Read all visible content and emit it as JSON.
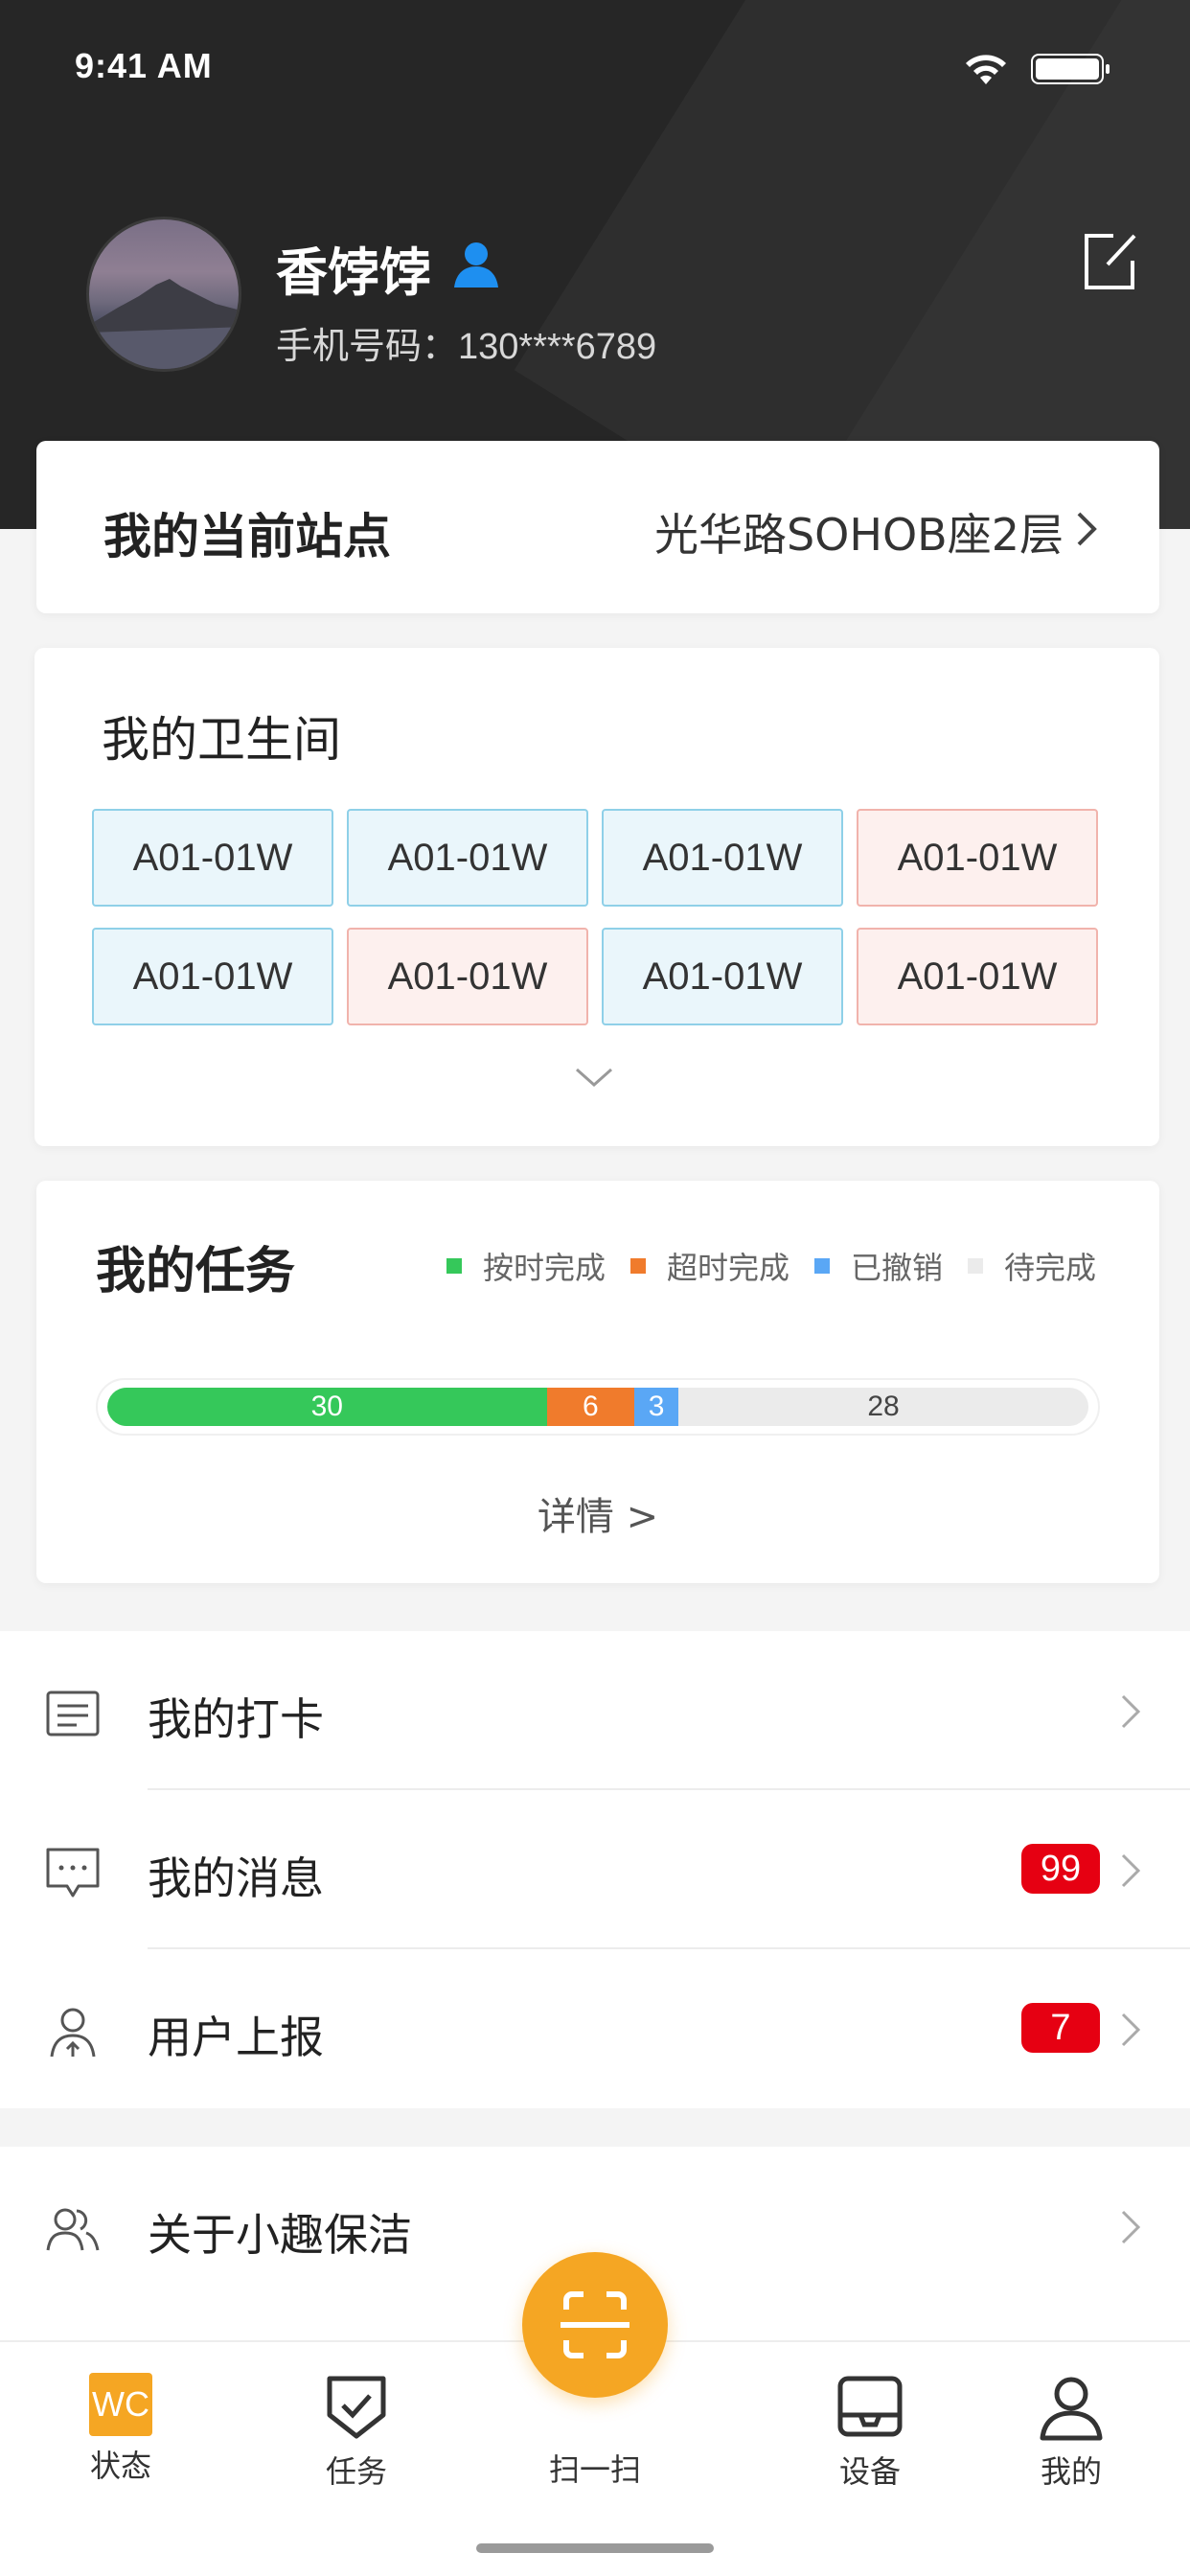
{
  "status_bar": {
    "time": "9:41 AM"
  },
  "profile": {
    "name": "香饽饽",
    "phone_label": "手机号码：",
    "phone": "130****6789"
  },
  "station": {
    "label": "我的当前站点",
    "value": "光华路SOHOB座2层"
  },
  "restrooms": {
    "title": "我的卫生间",
    "items": [
      {
        "code": "A01-01W",
        "status": "blue"
      },
      {
        "code": "A01-01W",
        "status": "blue"
      },
      {
        "code": "A01-01W",
        "status": "blue"
      },
      {
        "code": "A01-01W",
        "status": "red"
      },
      {
        "code": "A01-01W",
        "status": "blue"
      },
      {
        "code": "A01-01W",
        "status": "red"
      },
      {
        "code": "A01-01W",
        "status": "blue"
      },
      {
        "code": "A01-01W",
        "status": "red"
      }
    ]
  },
  "tasks": {
    "title": "我的任务",
    "legend": [
      {
        "label": "按时完成",
        "color": "#35c85a"
      },
      {
        "label": "超时完成",
        "color": "#f07b2c"
      },
      {
        "label": "已撤销",
        "color": "#5aa7f5"
      },
      {
        "label": "待完成",
        "color": "#ebebeb"
      }
    ],
    "progress": [
      {
        "value": 30,
        "label": "30"
      },
      {
        "value": 6,
        "label": "6"
      },
      {
        "value": 3,
        "label": "3"
      },
      {
        "value": 28,
        "label": "28"
      }
    ],
    "detail_label": "详情 >"
  },
  "menu": {
    "group1": [
      {
        "label": "我的打卡",
        "icon": "clock-in-icon",
        "badge": ""
      },
      {
        "label": "我的消息",
        "icon": "message-icon",
        "badge": "99"
      },
      {
        "label": "用户上报",
        "icon": "user-report-icon",
        "badge": "7"
      }
    ],
    "group2": [
      {
        "label": "关于小趣保洁",
        "icon": "about-users-icon",
        "badge": ""
      }
    ]
  },
  "tab_bar": {
    "tabs": [
      {
        "label": "状态",
        "icon": "wc-icon",
        "icon_text": "WC",
        "active": true
      },
      {
        "label": "任务",
        "icon": "task-shield-icon"
      },
      {
        "label": "扫一扫",
        "icon": "scan-icon"
      },
      {
        "label": "设备",
        "icon": "device-icon"
      },
      {
        "label": "我的",
        "icon": "profile-icon"
      }
    ]
  },
  "colors": {
    "accent": "#f5a623",
    "header_bg": "#262626",
    "badge": "#e60012",
    "verified": "#1e8ff0"
  }
}
